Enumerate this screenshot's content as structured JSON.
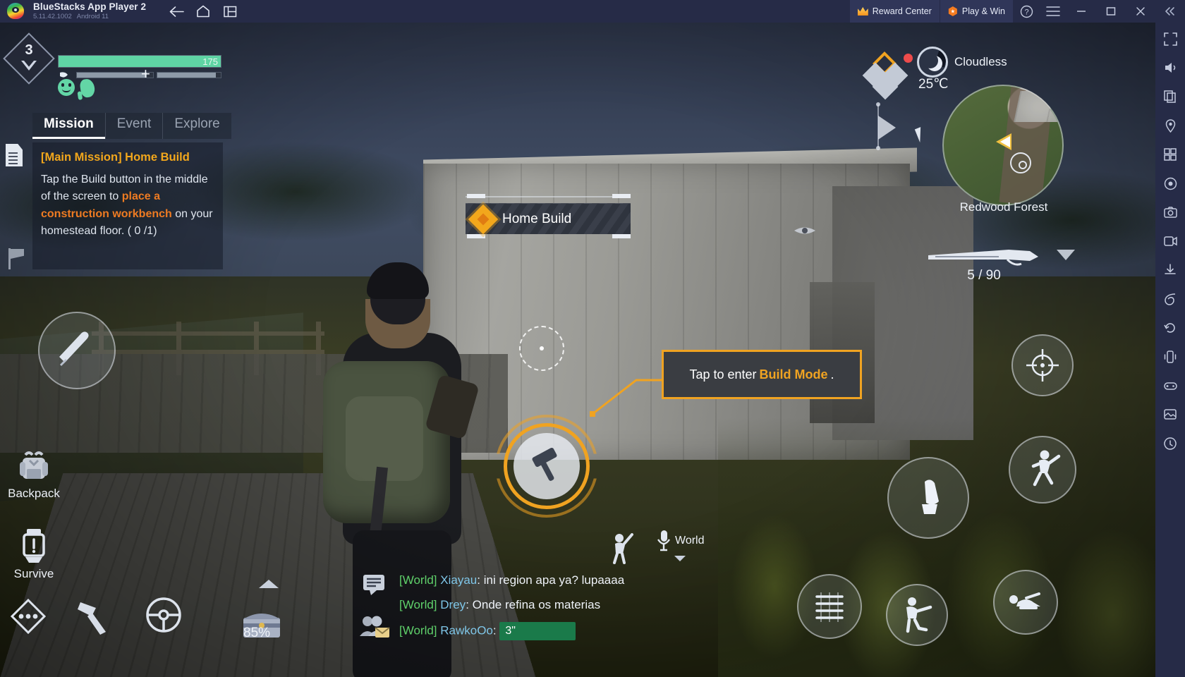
{
  "titlebar": {
    "app_name": "BlueStacks App Player 2",
    "version": "5.11.42.1002",
    "android": "Android 11",
    "nav": [
      {
        "name": "back-button",
        "label": "Back"
      },
      {
        "name": "home-button",
        "label": "Home"
      },
      {
        "name": "recents-button",
        "label": "Recent apps"
      }
    ],
    "reward_center": "Reward Center",
    "play_and_win": "Play & Win",
    "help": "?",
    "menu": "Menu",
    "minimize": "Minimize",
    "maximize": "Maximize",
    "close": "Close",
    "collapse": "Collapse",
    "bg_color": "#262b47",
    "pill_color": "#303659"
  },
  "sidebar": {
    "items": [
      {
        "name": "fullscreen-icon",
        "label": "Fullscreen"
      },
      {
        "name": "volume-icon",
        "label": "Volume"
      },
      {
        "name": "copy-icon",
        "label": "Copy to clipboard"
      },
      {
        "name": "location-icon",
        "label": "Location"
      },
      {
        "name": "multi-instance-icon",
        "label": "Multi-instance Manager"
      },
      {
        "name": "macro-icon",
        "label": "Macro Recorder"
      },
      {
        "name": "screenshot-icon",
        "label": "Screenshot"
      },
      {
        "name": "video-icon",
        "label": "Record screen"
      },
      {
        "name": "install-apk-icon",
        "label": "Install APK"
      },
      {
        "name": "eco-mode-icon",
        "label": "Eco Mode"
      },
      {
        "name": "rotate-icon",
        "label": "Rotate"
      },
      {
        "name": "shake-icon",
        "label": "Shake"
      },
      {
        "name": "gamepad-icon",
        "label": "Game controls"
      },
      {
        "name": "media-manager-icon",
        "label": "Media Manager"
      },
      {
        "name": "trim-memory-icon",
        "label": "Trim memory"
      }
    ]
  },
  "hud": {
    "level": "3",
    "health": {
      "value": "175",
      "percent": 100
    },
    "stamina_percent": 92,
    "medical_percent": 92,
    "status_icons": [
      "mood-icon",
      "stomach-icon"
    ],
    "tabs": [
      {
        "name": "tab-mission",
        "label": "Mission",
        "active": true
      },
      {
        "name": "tab-event",
        "label": "Event",
        "active": false
      },
      {
        "name": "tab-explore",
        "label": "Explore",
        "active": false
      }
    ],
    "mission": {
      "title": "[Main Mission] Home Build",
      "body_part1": "Tap the Build button in the middle of the screen to ",
      "body_highlight": "place a construction workbench",
      "body_part2": " on your homestead floor. ( 0 /1)",
      "title_color": "#f2a71c",
      "highlight_color": "#ee7b22"
    },
    "objective_banner": "Home Build",
    "tooltip": {
      "prefix": "Tap to enter",
      "accent": "Build Mode",
      "suffix": ".",
      "border_color": "#f0a321"
    },
    "weather": {
      "condition": "Cloudless",
      "temperature": "25℃"
    },
    "map_location": "Redwood Forest",
    "ammo": "5 / 90",
    "battery_percent": "85%",
    "voice_channel": "World",
    "left_buttons": [
      {
        "name": "backpack-button",
        "label": "Backpack"
      },
      {
        "name": "survive-button",
        "label": "Survive"
      }
    ],
    "bottom_buttons": [
      {
        "name": "more-actions-button",
        "label": "More"
      },
      {
        "name": "tool-hammer-button",
        "label": "Tool"
      },
      {
        "name": "vehicle-button",
        "label": "Vehicle"
      },
      {
        "name": "loot-crate-button",
        "label": "Loot"
      }
    ],
    "right_buttons": [
      {
        "name": "aim-button",
        "label": "Aim"
      },
      {
        "name": "jump-button",
        "label": "Jump"
      },
      {
        "name": "fire-button",
        "label": "Fire"
      },
      {
        "name": "reload-button",
        "label": "Reload"
      },
      {
        "name": "crouch-button",
        "label": "Crouch"
      },
      {
        "name": "prone-button",
        "label": "Prone"
      }
    ]
  },
  "chat": {
    "messages": [
      {
        "channel": "[World]",
        "user": "Xiayau",
        "text": "ini region apa ya? lupaaaa",
        "type": "text"
      },
      {
        "channel": "[World]",
        "user": "Drey",
        "text": "Onde refina os materias",
        "type": "text"
      },
      {
        "channel": "[World]",
        "user": "RawkoOo",
        "text": "3\"",
        "type": "voice"
      }
    ],
    "channel_color": "#5fd06a",
    "user_color": "#7fc6e8",
    "voice_bar_color": "#1a7a4a"
  }
}
